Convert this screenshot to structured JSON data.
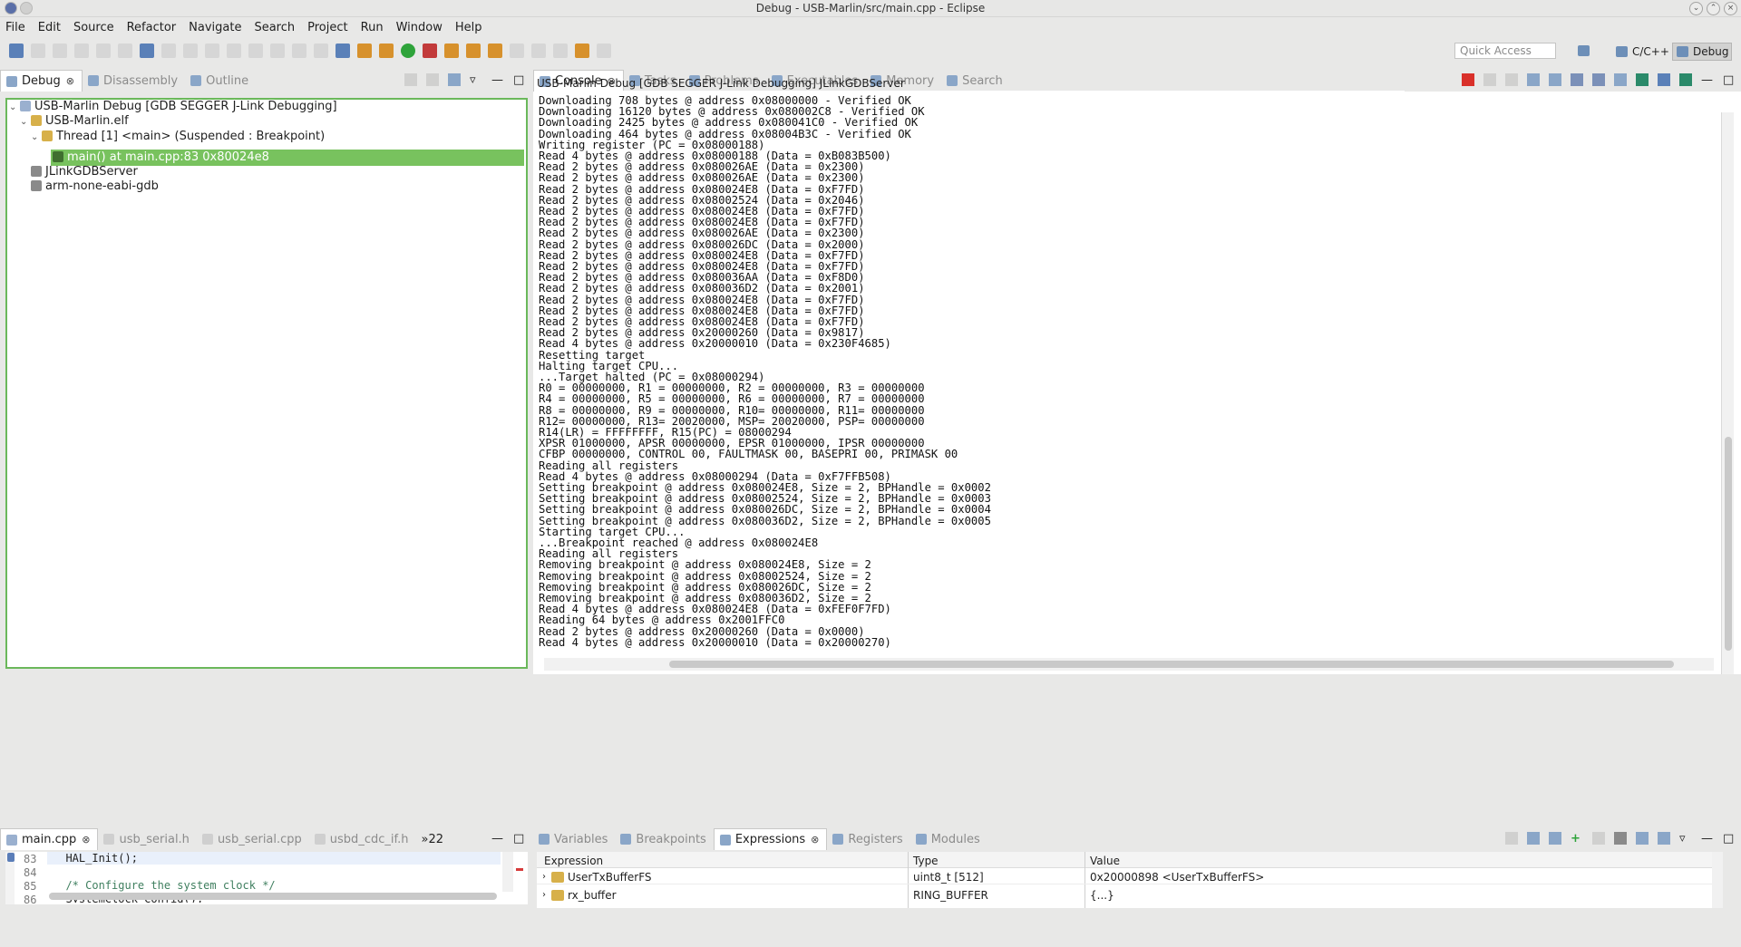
{
  "window": {
    "title": "Debug - USB-Marlin/src/main.cpp - Eclipse"
  },
  "menu": [
    "File",
    "Edit",
    "Source",
    "Refactor",
    "Navigate",
    "Search",
    "Project",
    "Run",
    "Window",
    "Help"
  ],
  "toolbar": {
    "quick_access_placeholder": "Quick Access",
    "perspective_cpp": "C/C++",
    "perspective_debug": "Debug"
  },
  "debug_panel": {
    "tabs": [
      "Debug",
      "Disassembly",
      "Outline"
    ],
    "tree": [
      "USB-Marlin Debug [GDB SEGGER J-Link Debugging]",
      "USB-Marlin.elf",
      "Thread [1] <main> (Suspended : Breakpoint)",
      "main() at main.cpp:83 0x80024e8",
      "JLinkGDBServer",
      "arm-none-eabi-gdb"
    ]
  },
  "console_panel": {
    "tabs": [
      "Console",
      "Tasks",
      "Problems",
      "Executables",
      "Memory",
      "Search"
    ],
    "header": "USB-Marlin Debug [GDB SEGGER J-Link Debugging] JLinkGDBServer",
    "lines": [
      "Downloading 708 bytes @ address 0x08000000 - Verified OK",
      "Downloading 16120 bytes @ address 0x080002C8 - Verified OK",
      "Downloading 2425 bytes @ address 0x080041C0 - Verified OK",
      "Downloading 464 bytes @ address 0x08004B3C - Verified OK",
      "Writing register (PC = 0x08000188)",
      "Read 4 bytes @ address 0x08000188 (Data = 0xB083B500)",
      "Read 2 bytes @ address 0x080026AE (Data = 0x2300)",
      "Read 2 bytes @ address 0x080026AE (Data = 0x2300)",
      "Read 2 bytes @ address 0x080024E8 (Data = 0xF7FD)",
      "Read 2 bytes @ address 0x08002524 (Data = 0x2046)",
      "Read 2 bytes @ address 0x080024E8 (Data = 0xF7FD)",
      "Read 2 bytes @ address 0x080024E8 (Data = 0xF7FD)",
      "Read 2 bytes @ address 0x080026AE (Data = 0x2300)",
      "Read 2 bytes @ address 0x080026DC (Data = 0x2000)",
      "Read 2 bytes @ address 0x080024E8 (Data = 0xF7FD)",
      "Read 2 bytes @ address 0x080024E8 (Data = 0xF7FD)",
      "Read 2 bytes @ address 0x080036AA (Data = 0xF8D0)",
      "Read 2 bytes @ address 0x080036D2 (Data = 0x2001)",
      "Read 2 bytes @ address 0x080024E8 (Data = 0xF7FD)",
      "Read 2 bytes @ address 0x080024E8 (Data = 0xF7FD)",
      "Read 2 bytes @ address 0x080024E8 (Data = 0xF7FD)",
      "Read 2 bytes @ address 0x20000260 (Data = 0x9817)",
      "Read 4 bytes @ address 0x20000010 (Data = 0x230F4685)",
      "Resetting target",
      "Halting target CPU...",
      "...Target halted (PC = 0x08000294)",
      "R0 = 00000000, R1 = 00000000, R2 = 00000000, R3 = 00000000",
      "R4 = 00000000, R5 = 00000000, R6 = 00000000, R7 = 00000000",
      "R8 = 00000000, R9 = 00000000, R10= 00000000, R11= 00000000",
      "R12= 00000000, R13= 20020000, MSP= 20020000, PSP= 00000000",
      "R14(LR) = FFFFFFFF, R15(PC) = 08000294",
      "XPSR 01000000, APSR 00000000, EPSR 01000000, IPSR 00000000",
      "CFBP 00000000, CONTROL 00, FAULTMASK 00, BASEPRI 00, PRIMASK 00",
      "Reading all registers",
      "Read 4 bytes @ address 0x08000294 (Data = 0xF7FFB508)",
      "Setting breakpoint @ address 0x080024E8, Size = 2, BPHandle = 0x0002",
      "Setting breakpoint @ address 0x08002524, Size = 2, BPHandle = 0x0003",
      "Setting breakpoint @ address 0x080026DC, Size = 2, BPHandle = 0x0004",
      "Setting breakpoint @ address 0x080036D2, Size = 2, BPHandle = 0x0005",
      "Starting target CPU...",
      "...Breakpoint reached @ address 0x080024E8",
      "Reading all registers",
      "Removing breakpoint @ address 0x080024E8, Size = 2",
      "Removing breakpoint @ address 0x08002524, Size = 2",
      "Removing breakpoint @ address 0x080026DC, Size = 2",
      "Removing breakpoint @ address 0x080036D2, Size = 2",
      "Read 4 bytes @ address 0x080024E8 (Data = 0xFEF0F7FD)",
      "Reading 64 bytes @ address 0x2001FFC0",
      "Read 2 bytes @ address 0x20000260 (Data = 0x0000)",
      "Read 4 bytes @ address 0x20000010 (Data = 0x20000270)"
    ]
  },
  "editor_panel": {
    "tabs": [
      "main.cpp",
      "usb_serial.h",
      "usb_serial.cpp",
      "usbd_cdc_if.h"
    ],
    "overflow_label": "»22",
    "lines": [
      {
        "num": "83",
        "code": "  HAL_Init();"
      },
      {
        "num": "84",
        "code": ""
      },
      {
        "num": "85",
        "code": "  /* Configure the system clock */"
      },
      {
        "num": "86",
        "code": "  SystemClock_Config();"
      }
    ]
  },
  "expressions_panel": {
    "tabs": [
      "Variables",
      "Breakpoints",
      "Expressions",
      "Registers",
      "Modules"
    ],
    "columns": [
      "Expression",
      "Type",
      "Value"
    ],
    "rows": [
      {
        "expression": "UserTxBufferFS",
        "type": "uint8_t [512]",
        "value": "0x20000898 <UserTxBufferFS>"
      },
      {
        "expression": "rx_buffer",
        "type": "RING_BUFFER",
        "value": "{...}"
      }
    ]
  }
}
